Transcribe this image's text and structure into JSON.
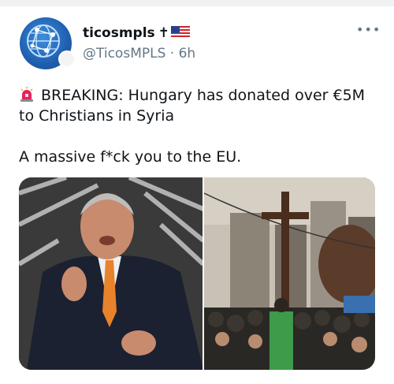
{
  "author": {
    "display_name": "ticosmpls",
    "emoji_badges": "✝🇺🇸",
    "handle": "@TicosMPLS",
    "separator": "·",
    "time": "6h",
    "avatar_icon": "globe-network-icon"
  },
  "menu": {
    "more_label": "•••"
  },
  "tweet": {
    "line1_icon": "police-siren-icon",
    "line1": "BREAKING: Hungary has donated over €5M to Christians in Syria",
    "line2": "A massive f*ck you to the EU."
  },
  "media": {
    "left_image": "man-speaking-photo",
    "right_image": "crowd-with-cross-photo"
  },
  "colors": {
    "text": "#0f1419",
    "secondary_text": "#657786",
    "avatar_blue": "#1f5fae",
    "siren_red": "#e0245e"
  }
}
